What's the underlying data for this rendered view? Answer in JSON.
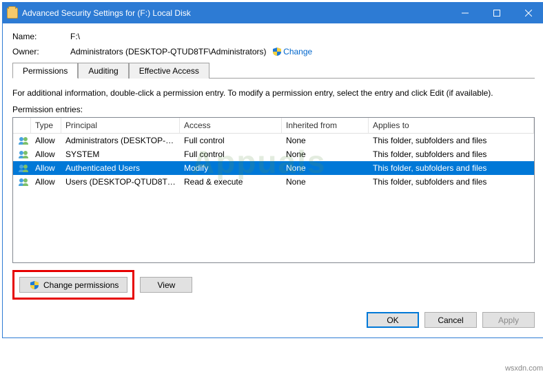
{
  "window": {
    "title": "Advanced Security Settings for (F:) Local Disk"
  },
  "labels": {
    "name": "Name:",
    "owner": "Owner:",
    "change_link": "Change",
    "info": "For additional information, double-click a permission entry. To modify a permission entry, select the entry and click Edit (if available).",
    "entries": "Permission entries:"
  },
  "values": {
    "name": "F:\\",
    "owner": "Administrators (DESKTOP-QTUD8TF\\Administrators)"
  },
  "tabs": {
    "permissions": "Permissions",
    "auditing": "Auditing",
    "effective": "Effective Access"
  },
  "columns": {
    "type": "Type",
    "principal": "Principal",
    "access": "Access",
    "inherited": "Inherited from",
    "applies": "Applies to"
  },
  "rows": [
    {
      "type": "Allow",
      "principal": "Administrators (DESKTOP-QT...",
      "access": "Full control",
      "inherited": "None",
      "applies": "This folder, subfolders and files",
      "selected": false
    },
    {
      "type": "Allow",
      "principal": "SYSTEM",
      "access": "Full control",
      "inherited": "None",
      "applies": "This folder, subfolders and files",
      "selected": false
    },
    {
      "type": "Allow",
      "principal": "Authenticated Users",
      "access": "Modify",
      "inherited": "None",
      "applies": "This folder, subfolders and files",
      "selected": true
    },
    {
      "type": "Allow",
      "principal": "Users (DESKTOP-QTUD8TF\\Us...",
      "access": "Read & execute",
      "inherited": "None",
      "applies": "This folder, subfolders and files",
      "selected": false
    }
  ],
  "buttons": {
    "change_permissions": "Change permissions",
    "view": "View",
    "ok": "OK",
    "cancel": "Cancel",
    "apply": "Apply"
  },
  "watermark": "Appuals",
  "footer_url": "wsxdn.com"
}
